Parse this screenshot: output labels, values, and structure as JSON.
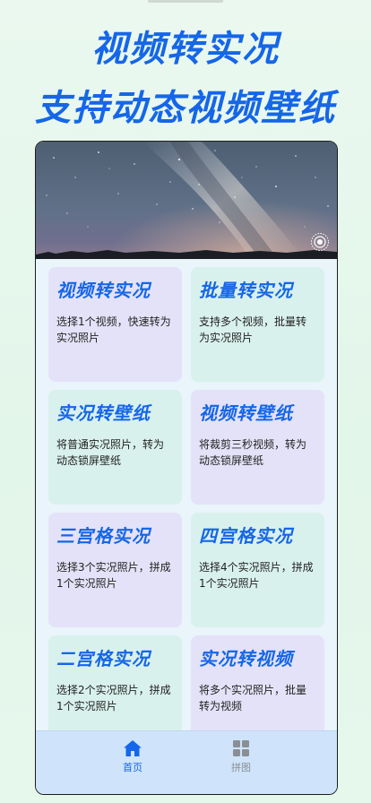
{
  "promo": {
    "line1": "视频转实况",
    "line2": "支持动态视频壁纸"
  },
  "hero": {
    "image": "milky-way-night-sky",
    "badge_icon": "live-photo-icon"
  },
  "cards": [
    {
      "title": "视频转实况",
      "desc": "选择1个视频，快速转为实况照片",
      "tone": "lavender"
    },
    {
      "title": "批量转实况",
      "desc": "支持多个视频，批量转为实况照片",
      "tone": "mint"
    },
    {
      "title": "实况转壁纸",
      "desc": "将普通实况照片，转为动态锁屏壁纸",
      "tone": "mint"
    },
    {
      "title": "视频转壁纸",
      "desc": "将裁剪三秒视频，转为动态锁屏壁纸",
      "tone": "lavender"
    },
    {
      "title": "三宫格实况",
      "desc": "选择3个实况照片，拼成1个实况照片",
      "tone": "lavender"
    },
    {
      "title": "四宫格实况",
      "desc": "选择4个实况照片，拼成1个实况照片",
      "tone": "mint"
    },
    {
      "title": "二宫格实况",
      "desc": "选择2个实况照片，拼成1个实况照片",
      "tone": "mint"
    },
    {
      "title": "实况转视频",
      "desc": "将多个实况照片，批量转为视频",
      "tone": "lavender"
    }
  ],
  "tabs": [
    {
      "label": "首页",
      "icon": "home-icon",
      "active": true
    },
    {
      "label": "拼图",
      "icon": "grid-icon",
      "active": false
    }
  ],
  "colors": {
    "accent": "#1566e8",
    "background": "#e6f7ec",
    "card_lavender": "#e4e2f8",
    "card_mint": "#d9f1ec",
    "tabbar": "#cfe4fb"
  }
}
